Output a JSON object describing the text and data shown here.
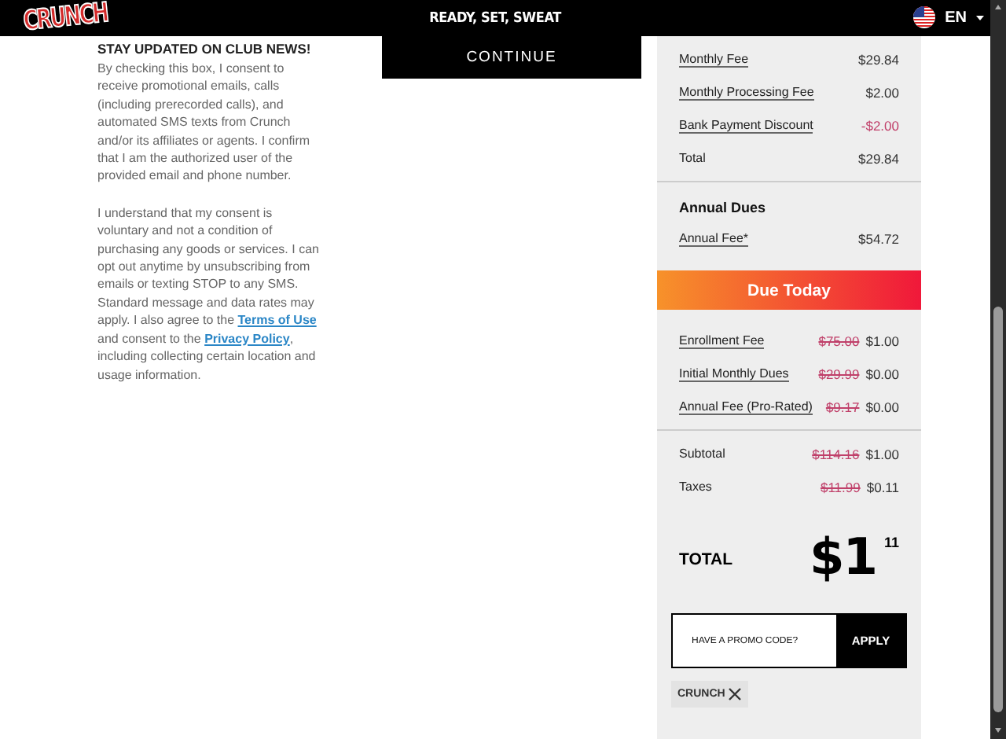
{
  "header": {
    "logo": "CRUNCH",
    "tagline": "READY, SET, SWEAT",
    "language": "EN"
  },
  "consent": {
    "heading": "STAY UPDATED ON CLUB NEWS!",
    "paragraph_1": "By checking this box, I consent to receive promotional emails, calls (including prerecorded calls), and automated SMS texts from Crunch and/or its affiliates or agents. I confirm that I am the authorized user of the provided email and phone number.",
    "paragraph_2": [
      {
        "kind": "text",
        "text": "I understand that my consent is voluntary and not a condition of purchasing any goods or services. I can opt out anytime by unsubscribing from emails or texting STOP to any SMS. Standard message and data rates may apply. I also agree to the "
      },
      {
        "kind": "link",
        "text": "Terms of Use"
      },
      {
        "kind": "text",
        "text": " and consent to the "
      },
      {
        "kind": "link",
        "text": "Privacy Policy"
      },
      {
        "kind": "text",
        "text": ", including collecting certain location and usage information."
      }
    ]
  },
  "continue_button": "CONTINUE",
  "monthly": [
    {
      "kind": "fee",
      "label": "Monthly Fee",
      "amount": "$29.84"
    },
    {
      "kind": "fee",
      "label": "Monthly Processing Fee",
      "amount": "$2.00"
    },
    {
      "kind": "discount",
      "label": "Bank Payment Discount",
      "amount": "-$2.00"
    },
    {
      "kind": "total",
      "label": "Total",
      "amount": "$29.84"
    }
  ],
  "annual": {
    "heading": "Annual Dues",
    "rows": [
      {
        "kind": "fee",
        "label": "Annual Fee*",
        "amount": "$54.72"
      }
    ]
  },
  "due_today": {
    "title": "Due Today",
    "rows": [
      {
        "kind": "fee",
        "label": "Enrollment Fee",
        "original": "$75.00",
        "amount": "$1.00"
      },
      {
        "kind": "fee",
        "label": "Initial Monthly Dues",
        "original": "$29.99",
        "amount": "$0.00"
      },
      {
        "kind": "fee",
        "label": "Annual Fee (Pro-Rated)",
        "original": "$9.17",
        "amount": "$0.00"
      }
    ],
    "summary": [
      {
        "kind": "total",
        "label": "Subtotal",
        "original": "$114.16",
        "amount": "$1.00"
      },
      {
        "kind": "total",
        "label": "Taxes",
        "original": "$11.99",
        "amount": "$0.11"
      }
    ]
  },
  "grand_total": {
    "label": "TOTAL",
    "dollars": "$1",
    "cents": "11"
  },
  "promo": {
    "placeholder": "HAVE A PROMO CODE?",
    "button": "APPLY",
    "applied": [
      "CRUNCH"
    ]
  }
}
